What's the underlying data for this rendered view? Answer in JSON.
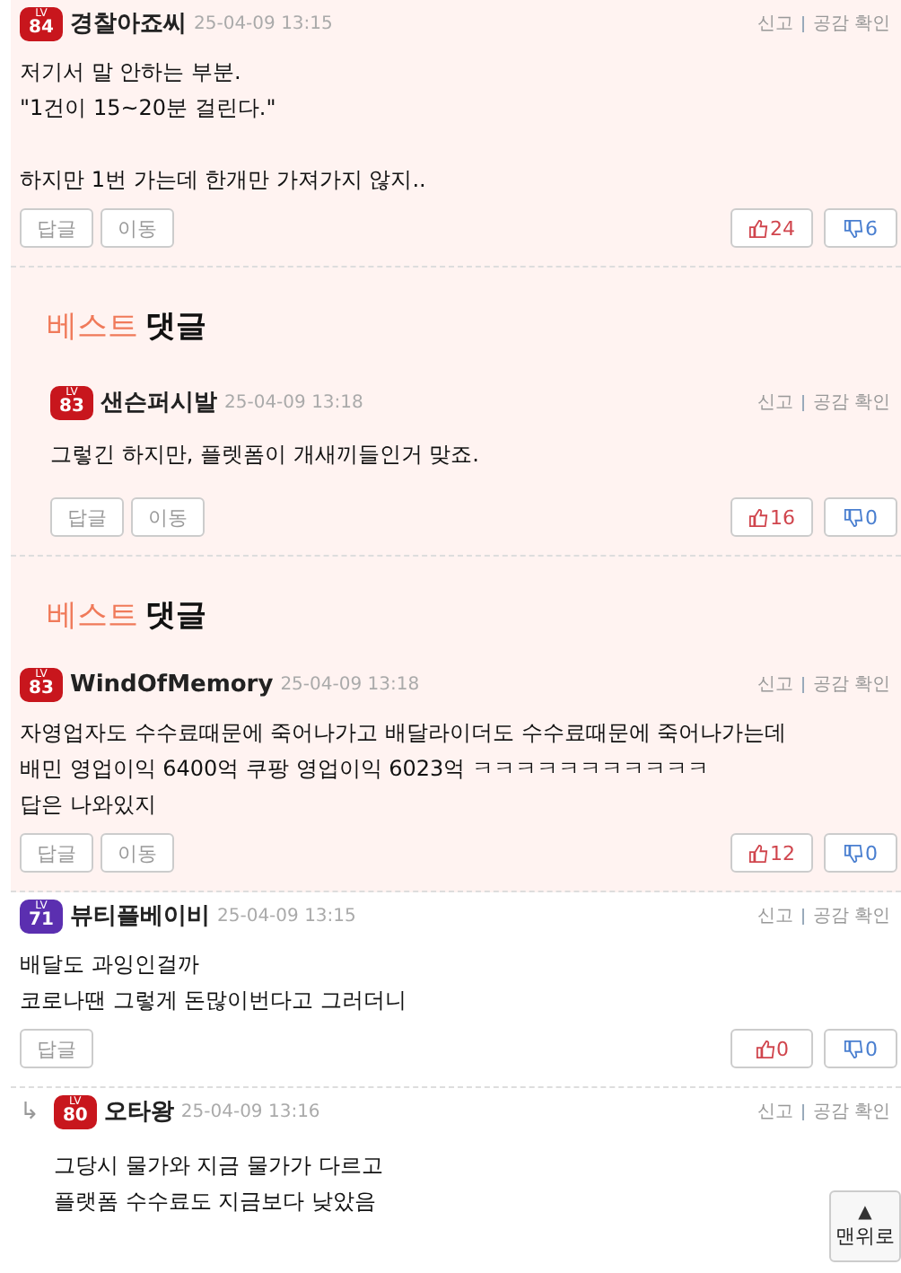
{
  "comments": [
    {
      "kind": "normal",
      "best": true,
      "badge": {
        "lv": "LV",
        "number": "84",
        "color": "#c8161d"
      },
      "author": "경찰아죠씨",
      "time": "25-04-09 13:15",
      "actions": [
        "신고",
        "공감 확인"
      ],
      "body": "저기서 말 안하는 부분.\n\"1건이 15~20분 걸린다.\"\n\n하지만 1번 가는데 한개만 가져가지 않지..",
      "buttons": [
        "답글",
        "이동"
      ],
      "up": "24",
      "down": "6"
    },
    {
      "kind": "nested",
      "best": true,
      "banner": {
        "prefix": "베스트",
        "word": "댓글"
      },
      "badge": {
        "lv": "LV",
        "number": "83",
        "color": "#c8161d"
      },
      "author": "샌슨퍼시발",
      "time": "25-04-09 13:18",
      "actions": [
        "신고",
        "공감 확인"
      ],
      "body": "그렇긴 하지만, 플렛폼이 개새끼들인거 맞죠.",
      "buttons": [
        "답글",
        "이동"
      ],
      "up": "16",
      "down": "0"
    },
    {
      "kind": "normal",
      "best": true,
      "banner": {
        "prefix": "베스트",
        "word": "댓글"
      },
      "badge": {
        "lv": "LV",
        "number": "83",
        "color": "#c8161d"
      },
      "author": "WindOfMemory",
      "time": "25-04-09 13:18",
      "actions": [
        "신고",
        "공감 확인"
      ],
      "body": "자영업자도 수수료때문에 죽어나가고 배달라이더도 수수료때문에 죽어나가는데\n배민 영업이익 6400억 쿠팡 영업이익 6023억 ㅋㅋㅋㅋㅋㅋㅋㅋㅋㅋㅋ\n답은 나와있지",
      "buttons": [
        "답글",
        "이동"
      ],
      "up": "12",
      "down": "0"
    },
    {
      "kind": "normal",
      "best": false,
      "badge": {
        "lv": "LV",
        "number": "71",
        "color": "#5b2fb0"
      },
      "author": "뷰티플베이비",
      "time": "25-04-09 13:15",
      "actions": [
        "신고",
        "공감 확인"
      ],
      "body": "배달도 과잉인걸까\n코로나땐 그렇게 돈많이번다고 그러더니",
      "buttons": [
        "답글"
      ],
      "up": "0",
      "down": "0"
    },
    {
      "kind": "reply",
      "best": false,
      "reply_mark": "↳",
      "badge": {
        "lv": "LV",
        "number": "80",
        "color": "#c8161d"
      },
      "author": "오타왕",
      "time": "25-04-09 13:16",
      "actions": [
        "신고",
        "공감 확인"
      ],
      "body": "그당시 물가와 지금 물가가 다르고\n플랫폼 수수료도 지금보다 낮았음"
    }
  ],
  "top_button": {
    "arrow": "▲",
    "label": "맨위로"
  }
}
